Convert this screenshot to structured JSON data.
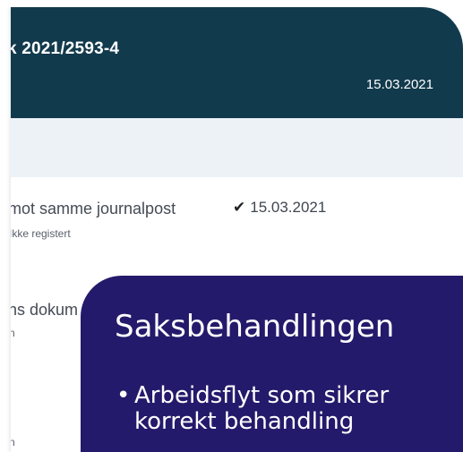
{
  "case": {
    "title": "k 2021/2593-4",
    "date": "15.03.2021"
  },
  "documents": [
    {
      "title": "mot samme journalpost",
      "subtitle": "Ikke registert",
      "status_icon": "checkmark",
      "status_date": "15.03.2021"
    },
    {
      "title": "ns dokum",
      "subtitle": "n"
    },
    {
      "subtitle": "n"
    }
  ],
  "overlay": {
    "heading": "Saksbehandlingen",
    "bullet_marker": "•",
    "bullet_text": "Arbeidsflyt som sikrer korrekt behandling"
  },
  "colors": {
    "header": "#123a4d",
    "overlay": "#241a6b",
    "subbar": "#edf2f7"
  }
}
